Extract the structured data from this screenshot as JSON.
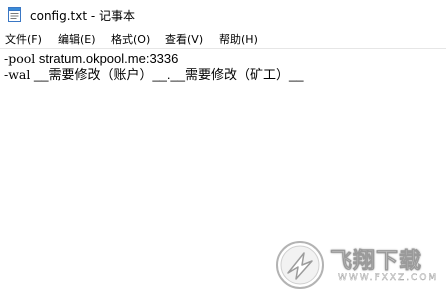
{
  "window": {
    "title": "config.txt - 记事本"
  },
  "menu": {
    "items": [
      {
        "label": "文件(F)"
      },
      {
        "label": "编辑(E)"
      },
      {
        "label": "格式(O)"
      },
      {
        "label": "查看(V)"
      },
      {
        "label": "帮助(H)"
      }
    ]
  },
  "editor": {
    "lines": [
      {
        "prefix": "-pool",
        "text": " stratum.okpool.me:3336"
      },
      {
        "prefix": "-wal",
        "text": " __需要修改（账户）__.__需要修改（矿工）__"
      }
    ]
  },
  "watermark": {
    "logo_text": "飞翔下载",
    "url_text": "WWW.FXXZ.COM"
  },
  "icons": {
    "app": "notepad-icon",
    "logo": "fxxz-logo-icon"
  }
}
